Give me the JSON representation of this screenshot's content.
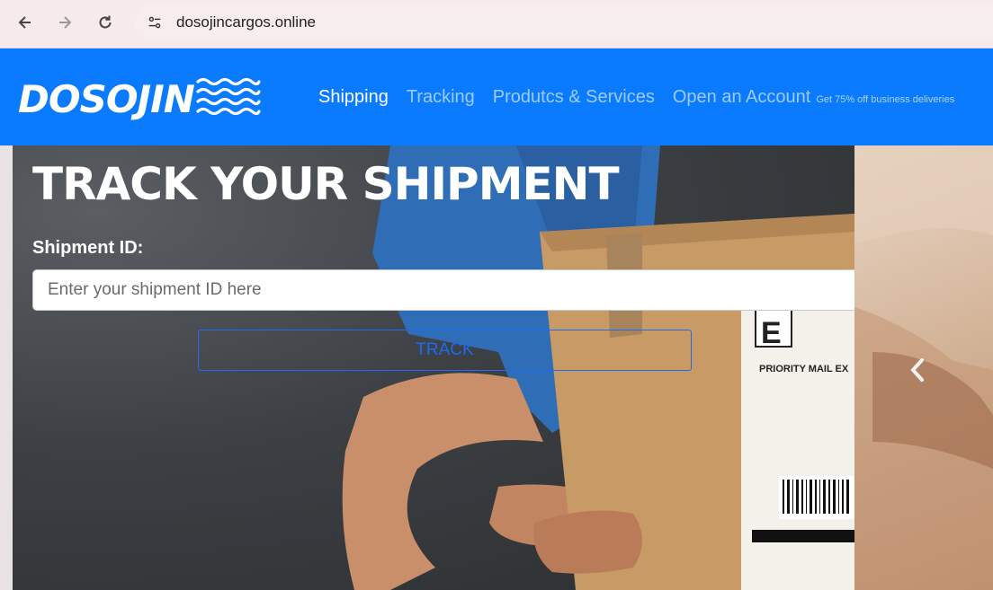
{
  "browser": {
    "url": "dosojincargos.online",
    "icons": {
      "back": "arrow-left-icon",
      "forward": "arrow-right-icon",
      "reload": "reload-icon",
      "site_info": "tune-icon"
    }
  },
  "header": {
    "logo_text": "DOSOJIN",
    "nav": {
      "shipping": "Shipping",
      "tracking": "Tracking",
      "products": "Produtcs & Services",
      "open_account": "Open an Account",
      "open_account_note": "Get 75% off business deliveries"
    },
    "colors": {
      "header_bg": "#0a7bff"
    }
  },
  "hero": {
    "title": "TRACK YOUR SHIPMENT",
    "field_label": "Shipment ID:",
    "input_placeholder": "Enter your shipment ID here",
    "button_label": "TRACK",
    "carousel_prev_icon": "chevron-left-icon",
    "colors": {
      "button_accent": "#1a6cf5"
    }
  }
}
